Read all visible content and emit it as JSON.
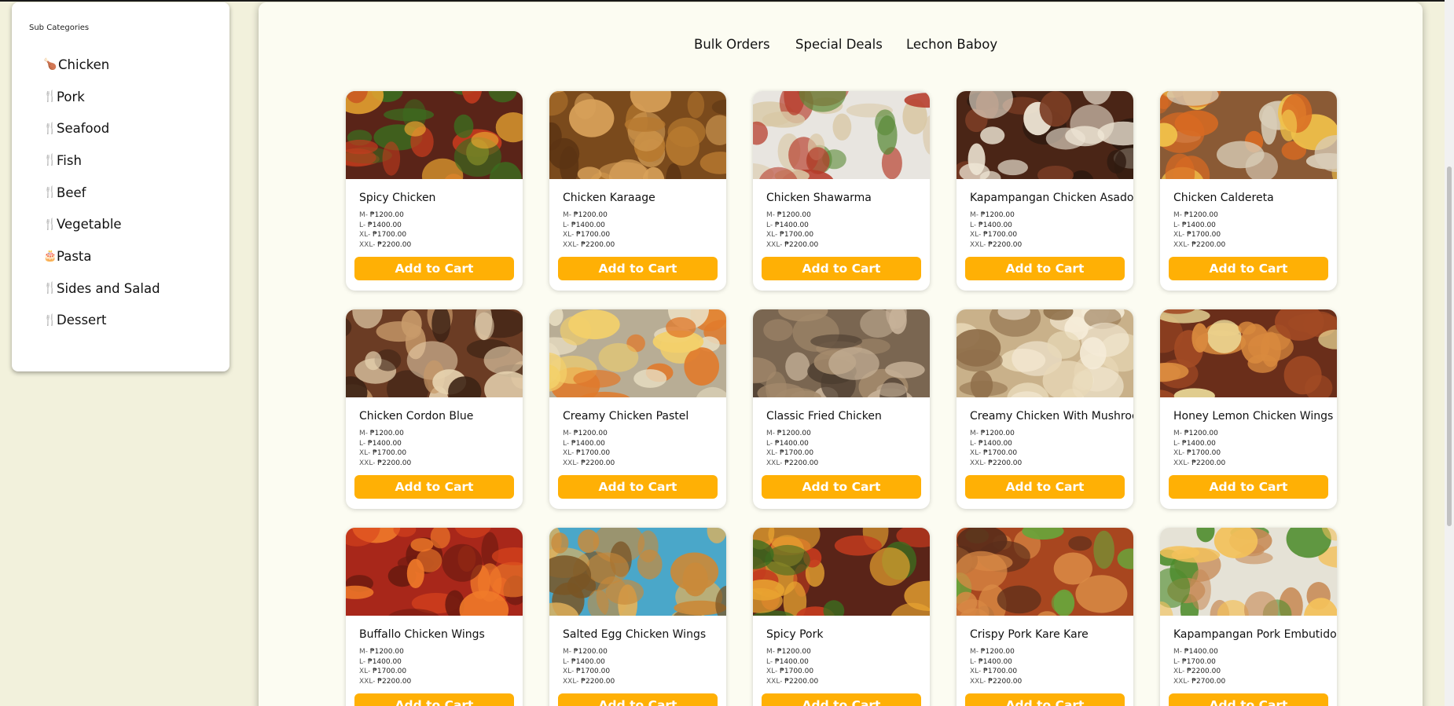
{
  "sidebar": {
    "title": "Sub Categories",
    "items": [
      {
        "label": "Chicken",
        "icon": "drumstick-icon"
      },
      {
        "label": "Pork",
        "icon": "utensils-icon"
      },
      {
        "label": "Seafood",
        "icon": "utensils-icon"
      },
      {
        "label": "Fish",
        "icon": "utensils-icon"
      },
      {
        "label": "Beef",
        "icon": "utensils-icon"
      },
      {
        "label": "Vegetable",
        "icon": "utensils-icon"
      },
      {
        "label": "Pasta",
        "icon": "cake-icon"
      },
      {
        "label": "Sides and Salad",
        "icon": "utensils-icon"
      },
      {
        "label": "Dessert",
        "icon": "utensils-icon"
      }
    ]
  },
  "nav": {
    "bulk": "Bulk Orders",
    "deals": "Special Deals",
    "lechon": "Lechon Baboy"
  },
  "cart_label": "Add to Cart",
  "colors": {
    "accent": "#ffb005",
    "page_bg": "#f2f1dc",
    "panel_bg": "#fcfcf2"
  },
  "products": [
    {
      "name": "Spicy Chicken",
      "prices": [
        [
          "M- ",
          "₱1200.00"
        ],
        [
          "L- ",
          "₱1400.00"
        ],
        [
          "XL- ",
          "₱1700.00"
        ],
        [
          "XXL- ",
          "₱2200.00"
        ]
      ]
    },
    {
      "name": "Chicken Karaage",
      "prices": [
        [
          "M- ",
          "₱1200.00"
        ],
        [
          "L- ",
          "₱1400.00"
        ],
        [
          "XL- ",
          "₱1700.00"
        ],
        [
          "XXL- ",
          "₱2200.00"
        ]
      ]
    },
    {
      "name": "Chicken Shawarma",
      "prices": [
        [
          "M- ",
          "₱1200.00"
        ],
        [
          "L- ",
          "₱1400.00"
        ],
        [
          "XL- ",
          "₱1700.00"
        ],
        [
          "XXL- ",
          "₱2200.00"
        ]
      ]
    },
    {
      "name": "Kapampangan Chicken Asado",
      "prices": [
        [
          "M- ",
          "₱1200.00"
        ],
        [
          "L- ",
          "₱1400.00"
        ],
        [
          "XL- ",
          "₱1700.00"
        ],
        [
          "XXL- ",
          "₱2200.00"
        ]
      ]
    },
    {
      "name": "Chicken Caldereta",
      "prices": [
        [
          "M- ",
          "₱1200.00"
        ],
        [
          "L- ",
          "₱1400.00"
        ],
        [
          "XL- ",
          "₱1700.00"
        ],
        [
          "XXL- ",
          "₱2200.00"
        ]
      ]
    },
    {
      "name": "Chicken Cordon Blue",
      "prices": [
        [
          "M- ",
          "₱1200.00"
        ],
        [
          "L- ",
          "₱1400.00"
        ],
        [
          "XL- ",
          "₱1700.00"
        ],
        [
          "XXL- ",
          "₱2200.00"
        ]
      ]
    },
    {
      "name": "Creamy Chicken Pastel",
      "prices": [
        [
          "M- ",
          "₱1200.00"
        ],
        [
          "L- ",
          "₱1400.00"
        ],
        [
          "XL- ",
          "₱1700.00"
        ],
        [
          "XXL- ",
          "₱2200.00"
        ]
      ]
    },
    {
      "name": "Classic Fried Chicken",
      "prices": [
        [
          "M- ",
          "₱1200.00"
        ],
        [
          "L- ",
          "₱1400.00"
        ],
        [
          "XL- ",
          "₱1700.00"
        ],
        [
          "XXL- ",
          "₱2200.00"
        ]
      ]
    },
    {
      "name": "Creamy Chicken With Mushroom",
      "prices": [
        [
          "M- ",
          "₱1200.00"
        ],
        [
          "L- ",
          "₱1400.00"
        ],
        [
          "XL- ",
          "₱1700.00"
        ],
        [
          "XXL- ",
          "₱2200.00"
        ]
      ]
    },
    {
      "name": "Honey Lemon Chicken Wings",
      "prices": [
        [
          "M- ",
          "₱1200.00"
        ],
        [
          "L- ",
          "₱1400.00"
        ],
        [
          "XL- ",
          "₱1700.00"
        ],
        [
          "XXL- ",
          "₱2200.00"
        ]
      ]
    },
    {
      "name": "Buffallo Chicken Wings",
      "prices": [
        [
          "M- ",
          "₱1200.00"
        ],
        [
          "L- ",
          "₱1400.00"
        ],
        [
          "XL- ",
          "₱1700.00"
        ],
        [
          "XXL- ",
          "₱2200.00"
        ]
      ]
    },
    {
      "name": "Salted Egg Chicken Wings",
      "prices": [
        [
          "M- ",
          "₱1200.00"
        ],
        [
          "L- ",
          "₱1400.00"
        ],
        [
          "XL- ",
          "₱1700.00"
        ],
        [
          "XXL- ",
          "₱2200.00"
        ]
      ]
    },
    {
      "name": "Spicy Pork",
      "prices": [
        [
          "M- ",
          "₱1200.00"
        ],
        [
          "L- ",
          "₱1400.00"
        ],
        [
          "XL- ",
          "₱1700.00"
        ],
        [
          "XXL- ",
          "₱2200.00"
        ]
      ]
    },
    {
      "name": "Crispy Pork Kare Kare",
      "prices": [
        [
          "M- ",
          "₱1200.00"
        ],
        [
          "L- ",
          "₱1400.00"
        ],
        [
          "XL- ",
          "₱1700.00"
        ],
        [
          "XXL- ",
          "₱2200.00"
        ]
      ]
    },
    {
      "name": "Kapampangan Pork Embutido",
      "prices": [
        [
          "M- ",
          "₱1400.00"
        ],
        [
          "L- ",
          "₱1700.00"
        ],
        [
          "XL- ",
          "₱2200.00"
        ],
        [
          "XXL- ",
          "₱2700.00"
        ]
      ]
    }
  ]
}
